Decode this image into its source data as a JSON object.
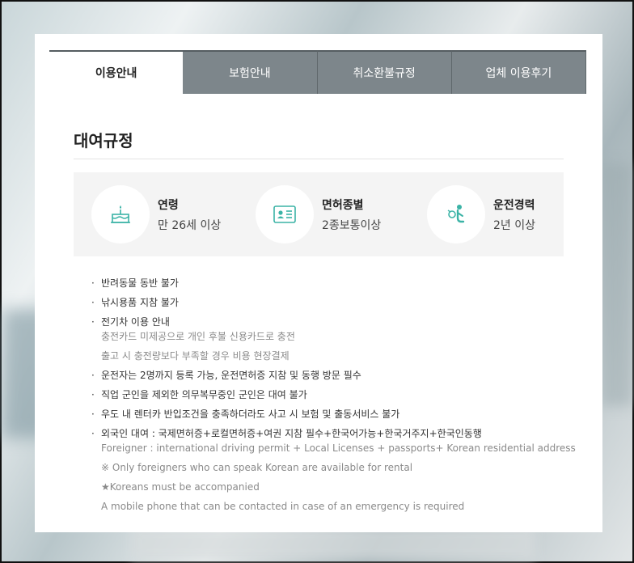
{
  "tabs": [
    {
      "label": "이용안내",
      "active": true
    },
    {
      "label": "보험안내",
      "active": false
    },
    {
      "label": "취소환불규정",
      "active": false
    },
    {
      "label": "업체 이용후기",
      "active": false
    }
  ],
  "section": {
    "title": "대여규정"
  },
  "summary": [
    {
      "icon": "cake-icon",
      "head": "연령",
      "value": "만 26세 이상"
    },
    {
      "icon": "license-card-icon",
      "head": "면허종별",
      "value": "2종보통이상"
    },
    {
      "icon": "driver-icon",
      "head": "운전경력",
      "value": "2년 이상"
    }
  ],
  "rules": {
    "pet": "반려동물 동반 불가",
    "fishing": "낚시용품 지참 불가",
    "ev_title": "전기차 이용 안내",
    "ev_line1": "충전카드 미제공으로 개인 후불 신용카드로 충전",
    "ev_line2": "출고 시 충전량보다 부족할 경우 비용 현장결제",
    "drivers": "운전자는 2명까지 등록 가능, 운전면허증 지참 및 동행 방문 필수",
    "military": "직업 군인을 제외한 의무복무중인 군인은 대여 불가",
    "insurance": "우도 내 렌터카 반입조건을 충족하더라도 사고 시 보험 및 출동서비스 불가",
    "foreigner_title": "외국인 대여 : 국제면허증+로컬면허증+여권 지참 필수+한국어가능+한국거주지+한국인동행",
    "foreigner_en1": "Foreigner : international driving permit + Local Licenses + passports+ Korean residential address",
    "foreigner_en2": "※ Only foreigners who can speak Korean are available for rental",
    "foreigner_en3": "★Koreans must be accompanied",
    "foreigner_en4": "A mobile phone that can be contacted in case of an emergency is required"
  },
  "colors": {
    "accent": "#3bb3a6",
    "tab_bg": "#7d868b"
  }
}
